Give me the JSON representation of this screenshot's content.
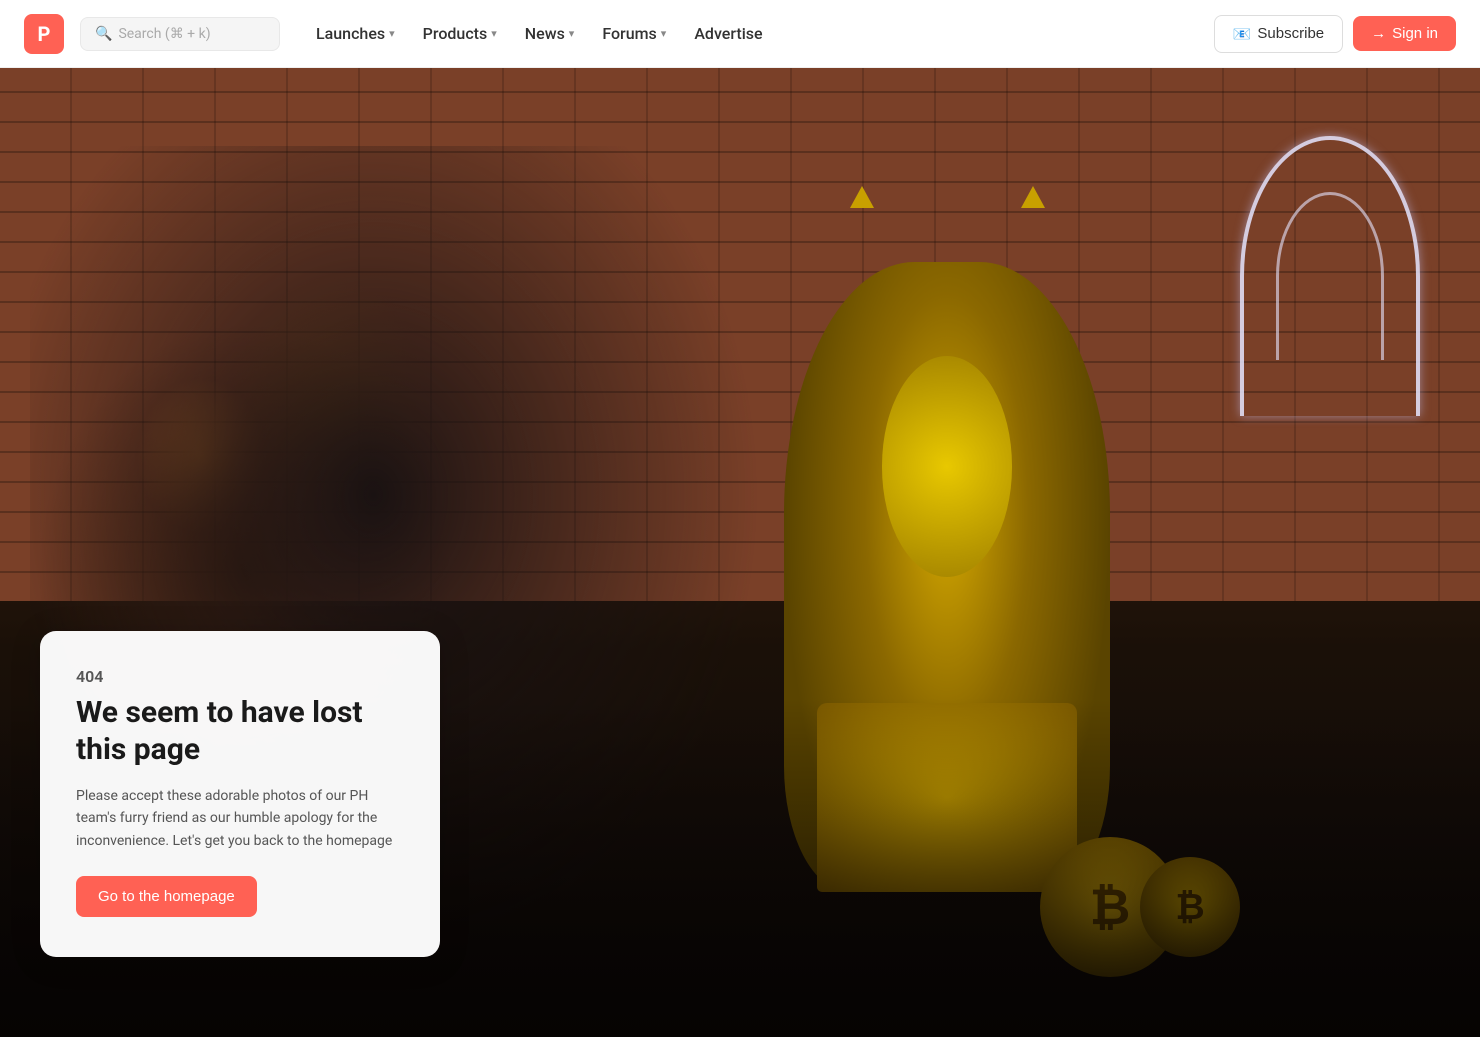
{
  "brand": {
    "logo_letter": "P",
    "logo_color": "#ff6154"
  },
  "search": {
    "placeholder": "Search (⌘ + k)"
  },
  "nav": {
    "items": [
      {
        "label": "Launches",
        "has_dropdown": true
      },
      {
        "label": "Products",
        "has_dropdown": true
      },
      {
        "label": "News",
        "has_dropdown": true
      },
      {
        "label": "Forums",
        "has_dropdown": true
      },
      {
        "label": "Advertise",
        "has_dropdown": false
      }
    ]
  },
  "actions": {
    "subscribe_label": "Subscribe",
    "signin_label": "Sign in"
  },
  "error": {
    "code": "404",
    "title": "We seem to have lost this page",
    "description": "Please accept these adorable photos of our PH team's furry friend as our humble apology for the inconvenience. Let's get you back to the homepage",
    "cta_label": "Go to the homepage"
  }
}
